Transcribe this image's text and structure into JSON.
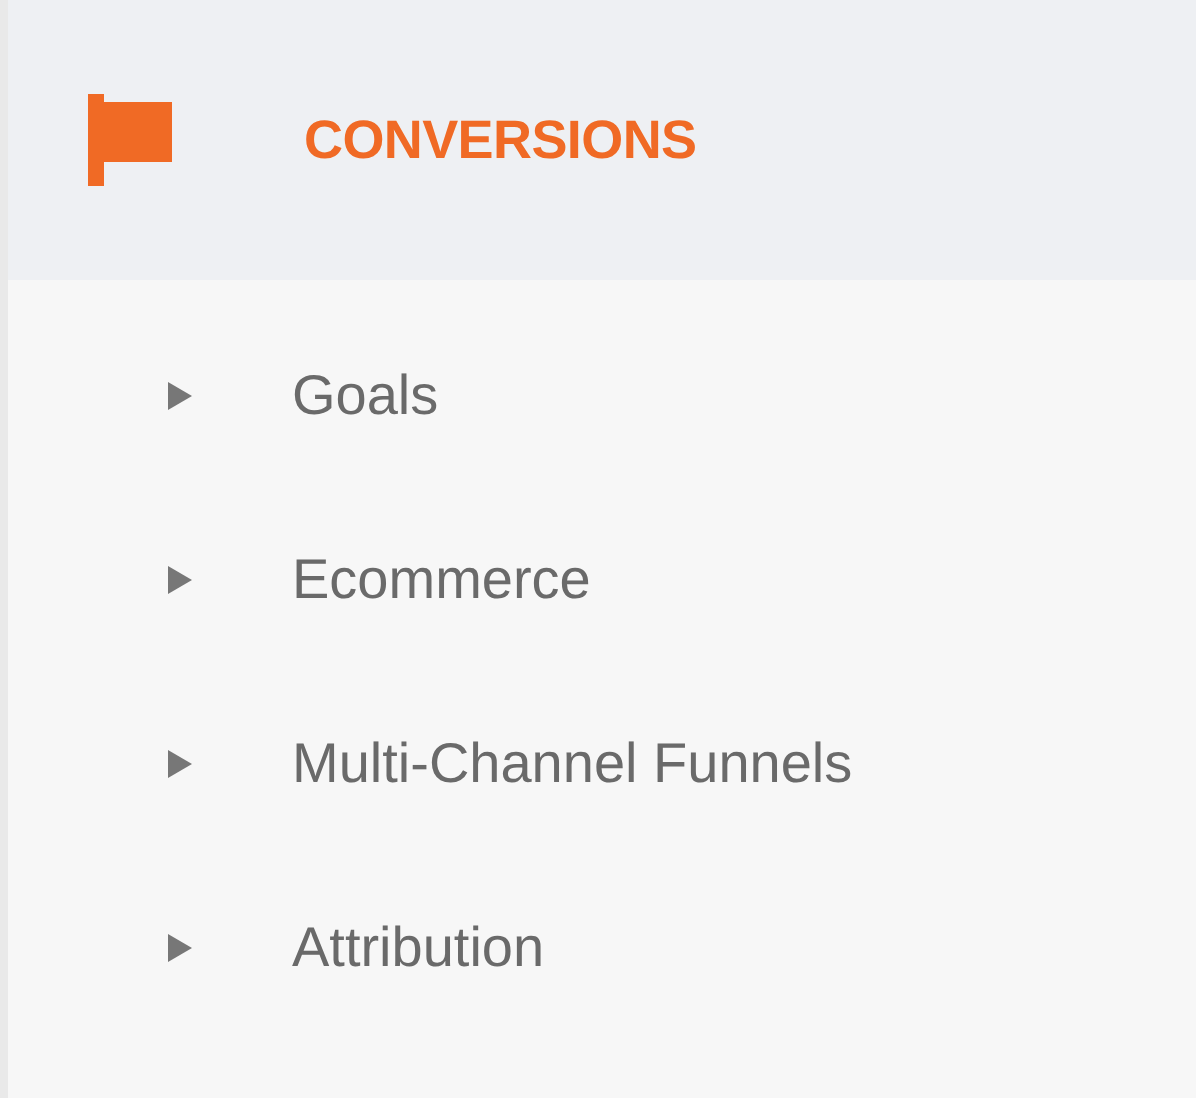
{
  "section": {
    "title": "CONVERSIONS",
    "selected": true
  },
  "items": [
    {
      "label": "Goals",
      "expanded": false
    },
    {
      "label": "Ecommerce",
      "expanded": false
    },
    {
      "label": "Multi-Channel Funnels",
      "expanded": false
    },
    {
      "label": "Attribution",
      "expanded": false
    }
  ]
}
